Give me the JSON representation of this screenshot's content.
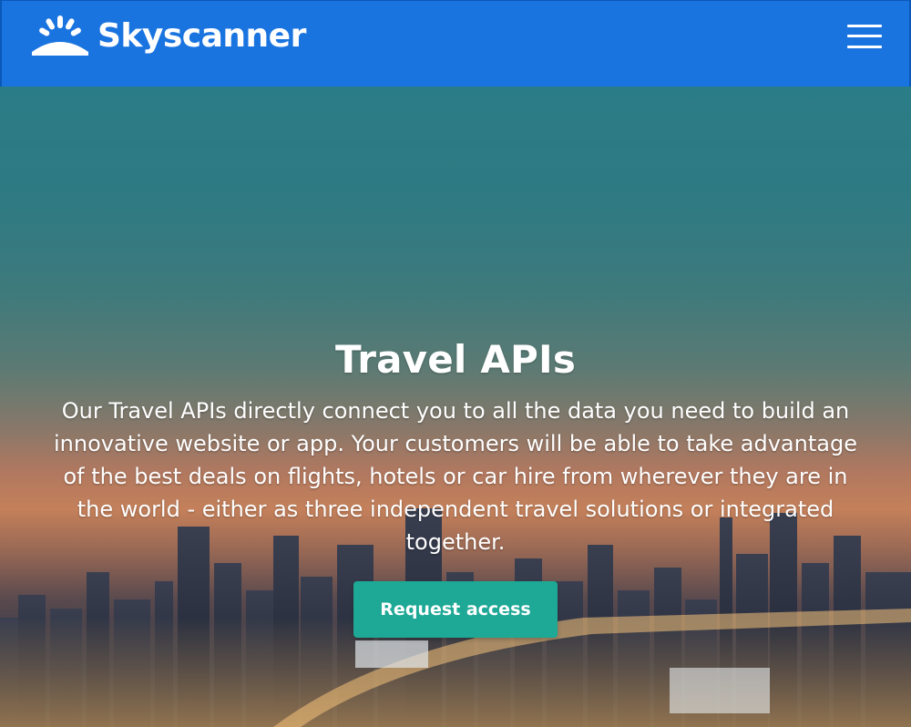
{
  "header": {
    "brand": "Skyscanner",
    "logo_icon": "sunburst-logo-icon",
    "menu_icon": "hamburger-menu-icon",
    "background_color": "#1a74e0"
  },
  "hero": {
    "title": "Travel APIs",
    "description": "Our Travel APIs directly connect you to all the data you need to build an innovative website or app. Your customers will be able to take advantage of the best deals on flights, hotels or car hire from wherever they are in the world - either as three independent travel solutions or integrated together.",
    "cta_label": "Request access",
    "cta_color": "#1ea896",
    "background_image": "city-skyline-at-sunset"
  }
}
